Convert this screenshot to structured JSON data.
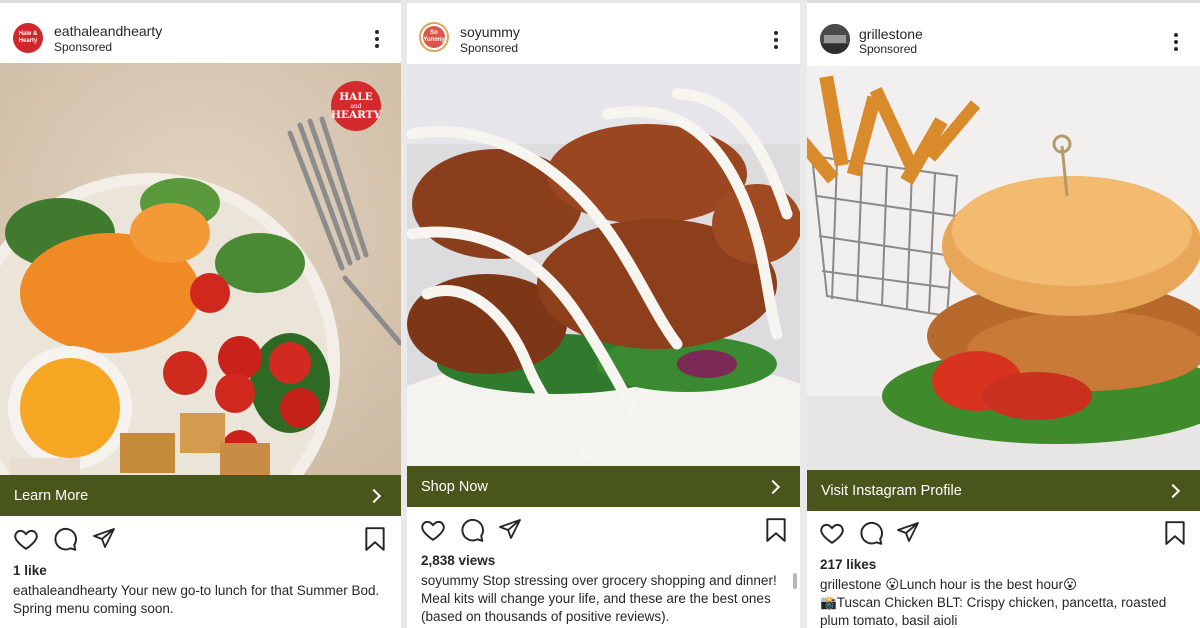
{
  "posts": [
    {
      "username": "eathaleandhearty",
      "sponsored": "Sponsored",
      "avatar_text": "Hale & Hearty",
      "image_badge": {
        "line1": "HALE",
        "line2": "and",
        "line3": "HEARTY"
      },
      "image_desc": "salad-bowl-photo",
      "cta_label": "Learn More",
      "metric": "1 like",
      "caption_user": "eathaleandhearty",
      "caption_text": " Your new go-to lunch for that Summer Bod. Spring menu coming soon."
    },
    {
      "username": "soyummy",
      "sponsored": "Sponsored",
      "avatar_text": "So Yummy",
      "image_desc": "chicken-rice-photo",
      "cta_label": "Shop Now",
      "metric": "2,838 views",
      "caption_user": "soyummy",
      "caption_text": " Stop stressing over grocery shopping and dinner! Meal kits will change your life, and these are the best ones (based on thousands of positive reviews)."
    },
    {
      "username": "grillestone",
      "sponsored": "Sponsored",
      "image_desc": "chicken-sandwich-photo",
      "cta_label": "Visit Instagram Profile",
      "metric": "217 likes",
      "caption_user": "grillestone",
      "caption_text": " 😮Lunch hour is the best hour😮",
      "caption_text2": "📸Tuscan Chicken BLT: Crispy chicken, pancetta, roasted plum tomato, basil aioli"
    }
  ],
  "colors": {
    "cta": "#48561c",
    "hale_red": "#d32a2e",
    "text": "#262626"
  }
}
